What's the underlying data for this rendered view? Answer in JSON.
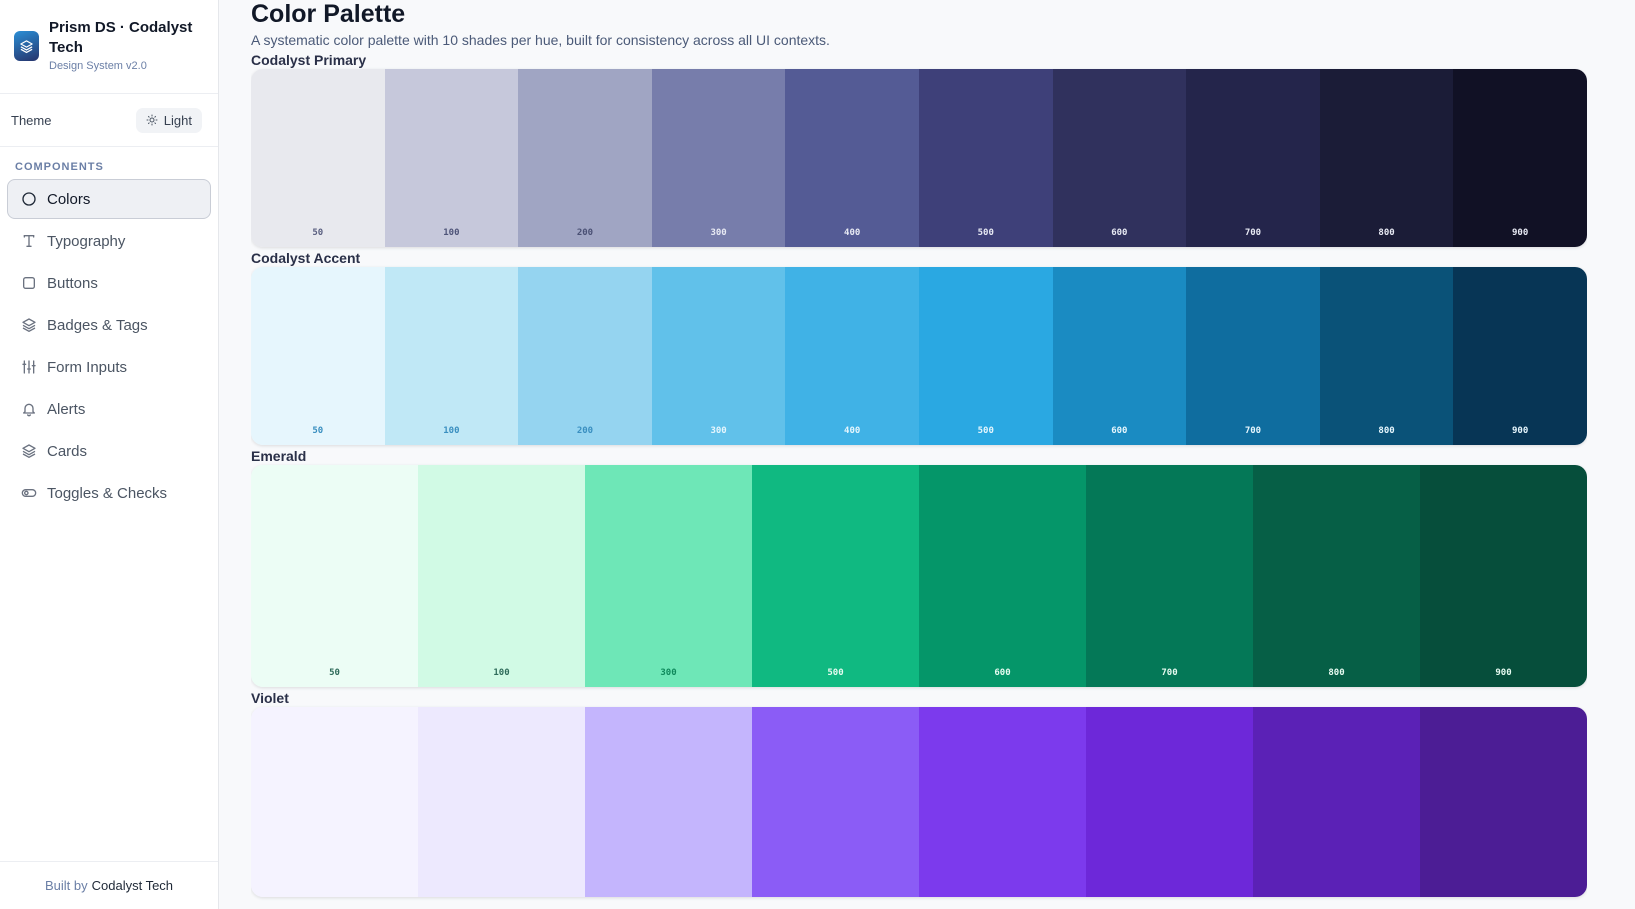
{
  "brand": {
    "name": "Prism DS · Codalyst Tech",
    "subtitle": "Design System v2.0"
  },
  "theme": {
    "label": "Theme",
    "button_label": "Light"
  },
  "nav": {
    "section_label": "COMPONENTS",
    "items": [
      {
        "label": "Colors",
        "icon": "circle-icon",
        "active": true
      },
      {
        "label": "Typography",
        "icon": "type-icon"
      },
      {
        "label": "Buttons",
        "icon": "square-icon"
      },
      {
        "label": "Badges & Tags",
        "icon": "layers-icon"
      },
      {
        "label": "Form Inputs",
        "icon": "sliders-icon"
      },
      {
        "label": "Alerts",
        "icon": "bell-icon"
      },
      {
        "label": "Cards",
        "icon": "layers-icon"
      },
      {
        "label": "Toggles & Checks",
        "icon": "toggle-icon"
      }
    ]
  },
  "footer": {
    "prefix": "Built by",
    "author": "Codalyst Tech"
  },
  "page": {
    "title": "Color Palette",
    "subtitle": "A systematic color palette with 10 shades per hue, built for consistency across all UI contexts."
  },
  "palettes": [
    {
      "name": "Codalyst Primary",
      "shades": [
        {
          "label": "50",
          "color": "#e8e9ee",
          "text": "#5a5f80"
        },
        {
          "label": "100",
          "color": "#c6c8db",
          "text": "#4e5478"
        },
        {
          "label": "200",
          "color": "#a0a5c3",
          "text": "#4a5074"
        },
        {
          "label": "300",
          "color": "#777dab",
          "text": "#e8eaf4"
        },
        {
          "label": "400",
          "color": "#545b95",
          "text": "#e8eaf4"
        },
        {
          "label": "500",
          "color": "#3e4079",
          "text": "#e8eaf4"
        },
        {
          "label": "600",
          "color": "#30315d",
          "text": "#e8eaf4"
        },
        {
          "label": "700",
          "color": "#24254b",
          "text": "#e8eaf4"
        },
        {
          "label": "800",
          "color": "#1b1c37",
          "text": "#e8eaf4"
        },
        {
          "label": "900",
          "color": "#111125",
          "text": "#e8eaf4"
        }
      ]
    },
    {
      "name": "Codalyst Accent",
      "shades": [
        {
          "label": "50",
          "color": "#e6f6fd",
          "text": "#3a8fc0"
        },
        {
          "label": "100",
          "color": "#c0e8f6",
          "text": "#3a8fc0"
        },
        {
          "label": "200",
          "color": "#95d4f0",
          "text": "#3a8fc0"
        },
        {
          "label": "300",
          "color": "#61c1ea",
          "text": "#e6f6fd"
        },
        {
          "label": "400",
          "color": "#40b2e6",
          "text": "#e6f6fd"
        },
        {
          "label": "500",
          "color": "#2aa8e2",
          "text": "#e6f6fd"
        },
        {
          "label": "600",
          "color": "#1a8bc2",
          "text": "#e6f6fd"
        },
        {
          "label": "700",
          "color": "#0f6d9f",
          "text": "#e6f6fd"
        },
        {
          "label": "800",
          "color": "#0a5278",
          "text": "#e6f6fd"
        },
        {
          "label": "900",
          "color": "#073555",
          "text": "#e6f6fd"
        }
      ]
    },
    {
      "name": "Emerald",
      "shades": [
        {
          "label": "50",
          "color": "#ecfdf5",
          "text": "#2f6b5a"
        },
        {
          "label": "100",
          "color": "#d1fae5",
          "text": "#2f6b5a"
        },
        {
          "label": "300",
          "color": "#6ee7b7",
          "text": "#0f8a5c"
        },
        {
          "label": "500",
          "color": "#10b981",
          "text": "#e6fbf1"
        },
        {
          "label": "600",
          "color": "#059669",
          "text": "#e6fbf1"
        },
        {
          "label": "700",
          "color": "#047857",
          "text": "#e6fbf1"
        },
        {
          "label": "800",
          "color": "#065f46",
          "text": "#e6fbf1"
        },
        {
          "label": "900",
          "color": "#064e3b",
          "text": "#e6fbf1"
        }
      ]
    },
    {
      "name": "Violet",
      "shades": [
        {
          "label": "",
          "color": "#f5f3ff",
          "text": "#6d28d9"
        },
        {
          "label": "",
          "color": "#ede9fe",
          "text": "#6d28d9"
        },
        {
          "label": "",
          "color": "#c4b5fd",
          "text": "#6d28d9"
        },
        {
          "label": "",
          "color": "#8b5cf6",
          "text": "#f5f3ff"
        },
        {
          "label": "",
          "color": "#7c3aed",
          "text": "#f5f3ff"
        },
        {
          "label": "",
          "color": "#6d28d9",
          "text": "#f5f3ff"
        },
        {
          "label": "",
          "color": "#5b21b6",
          "text": "#f5f3ff"
        },
        {
          "label": "",
          "color": "#4c1d95",
          "text": "#f5f3ff"
        }
      ]
    }
  ]
}
